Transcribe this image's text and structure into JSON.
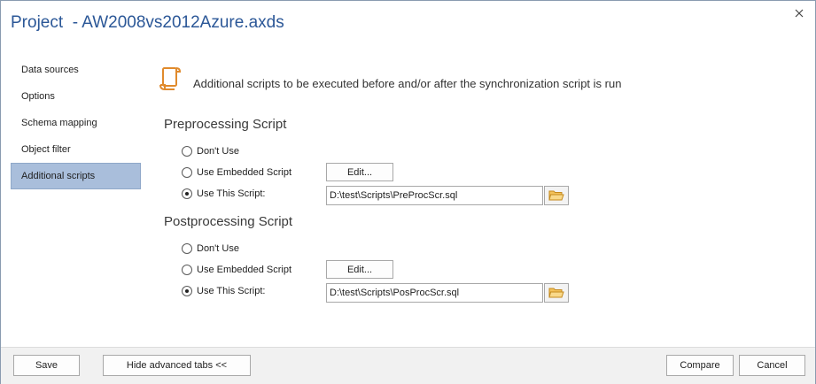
{
  "window": {
    "title": "Project  - AW2008vs2012Azure.axds"
  },
  "sidebar": {
    "items": [
      {
        "label": "Data sources"
      },
      {
        "label": "Options"
      },
      {
        "label": "Schema mapping"
      },
      {
        "label": "Object filter"
      },
      {
        "label": "Additional scripts",
        "active": true
      }
    ]
  },
  "main": {
    "header_text": "Additional scripts to be executed before and/or after the synchronization script is run",
    "header_icon": "scroll-icon",
    "preprocessing": {
      "title": "Preprocessing Script",
      "options": [
        "Don't Use",
        "Use Embedded Script",
        "Use This Script:"
      ],
      "selected_index": 2,
      "edit_label": "Edit...",
      "path": "D:\\test\\Scripts\\PreProcScr.sql"
    },
    "postprocessing": {
      "title": "Postprocessing Script",
      "options": [
        "Don't Use",
        "Use Embedded Script",
        "Use This Script:"
      ],
      "selected_index": 2,
      "edit_label": "Edit...",
      "path": "D:\\test\\Scripts\\PosProcScr.sql"
    }
  },
  "footer": {
    "save_label": "Save",
    "hide_tabs_label": "Hide advanced tabs <<",
    "compare_label": "Compare",
    "cancel_label": "Cancel"
  },
  "colors": {
    "title": "#2b5797",
    "active_item_bg": "#a9bedb",
    "icon_accent": "#e08a2c"
  }
}
